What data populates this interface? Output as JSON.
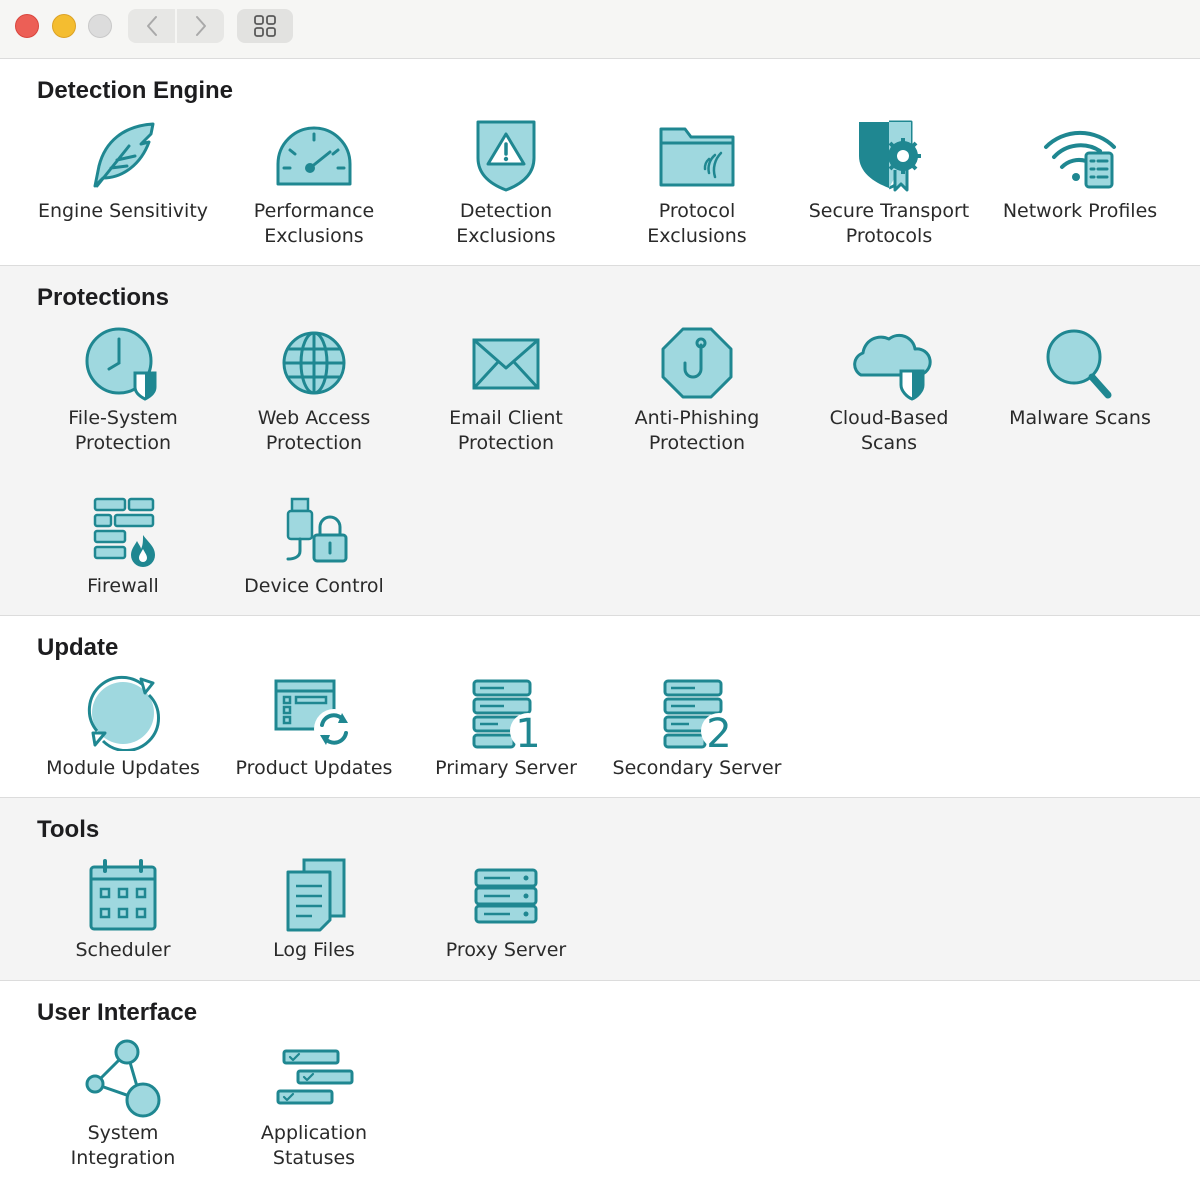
{
  "toolbar": {
    "back": "back-chevron-icon",
    "forward": "forward-chevron-icon",
    "grid_view": "grid-icon"
  },
  "sections": [
    {
      "title": "Detection Engine",
      "items": [
        {
          "label": "Engine Sensitivity",
          "icon": "feather-icon"
        },
        {
          "label": "Performance\nExclusions",
          "icon": "gauge-icon"
        },
        {
          "label": "Detection\nExclusions",
          "icon": "warning-shield-icon"
        },
        {
          "label": "Protocol\nExclusions",
          "icon": "folder-signal-icon"
        },
        {
          "label": "Secure Transport\nProtocols",
          "icon": "shield-gear-icon"
        },
        {
          "label": "Network Profiles",
          "icon": "wifi-list-icon"
        }
      ]
    },
    {
      "title": "Protections",
      "items": [
        {
          "label": "File-System\nProtection",
          "icon": "clock-shield-icon"
        },
        {
          "label": "Web Access\nProtection",
          "icon": "globe-icon"
        },
        {
          "label": "Email Client\nProtection",
          "icon": "envelope-icon"
        },
        {
          "label": "Anti-Phishing\nProtection",
          "icon": "hook-octagon-icon"
        },
        {
          "label": "Cloud-Based\nScans",
          "icon": "cloud-shield-icon"
        },
        {
          "label": "Malware Scans",
          "icon": "magnifier-icon"
        },
        {
          "label": "Firewall",
          "icon": "brick-flame-icon"
        },
        {
          "label": "Device Control",
          "icon": "usb-lock-icon"
        }
      ]
    },
    {
      "title": "Update",
      "items": [
        {
          "label": "Module Updates",
          "icon": "refresh-circle-icon"
        },
        {
          "label": "Product Updates",
          "icon": "app-refresh-icon"
        },
        {
          "label": "Primary Server",
          "icon": "server-1-icon",
          "badge": "1"
        },
        {
          "label": "Secondary Server",
          "icon": "server-2-icon",
          "badge": "2"
        }
      ]
    },
    {
      "title": "Tools",
      "items": [
        {
          "label": "Scheduler",
          "icon": "calendar-icon"
        },
        {
          "label": "Log Files",
          "icon": "documents-icon"
        },
        {
          "label": "Proxy Server",
          "icon": "server-stack-icon"
        }
      ]
    },
    {
      "title": "User Interface",
      "items": [
        {
          "label": "System\nIntegration",
          "icon": "share-nodes-icon"
        },
        {
          "label": "Application\nStatuses",
          "icon": "checklist-icon"
        }
      ]
    }
  ]
}
